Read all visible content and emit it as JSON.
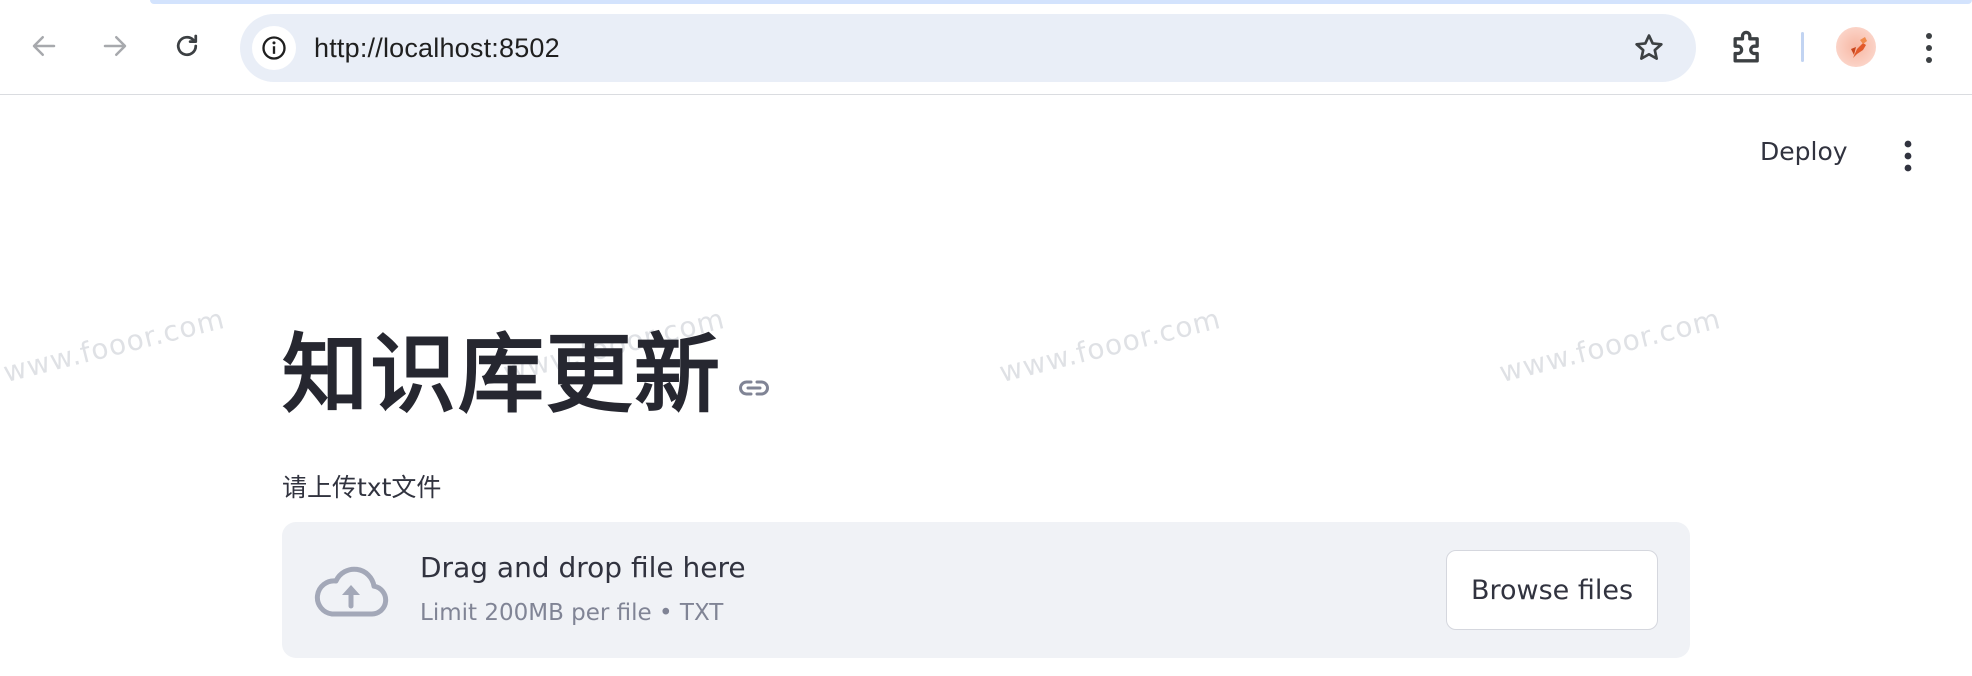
{
  "browser": {
    "url": "http://localhost:8502",
    "icons": {
      "back": "arrow-left-icon",
      "forward": "arrow-right-icon",
      "reload": "reload-icon",
      "site_info": "info-icon",
      "bookmark": "star-icon",
      "extensions": "puzzle-icon",
      "profile": "avatar",
      "menu": "kebab-menu-icon"
    },
    "colors": {
      "omnibox_bg": "#e9eef7",
      "tab_accent": "#d3e3fd"
    }
  },
  "app": {
    "header": {
      "deploy_label": "Deploy",
      "menu_icon": "kebab-menu-icon"
    },
    "watermark_text": "www.fooor.com",
    "title": "知识库更新",
    "title_anchor_icon": "link-icon",
    "uploader": {
      "label": "请上传txt文件",
      "drop_title": "Drag and drop file here",
      "limit_text": "Limit 200MB per file • TXT",
      "browse_label": "Browse files",
      "icon": "cloud-upload-icon"
    },
    "colors": {
      "dropzone_bg": "#f0f2f6",
      "text": "#31333f",
      "muted": "#808495"
    }
  }
}
